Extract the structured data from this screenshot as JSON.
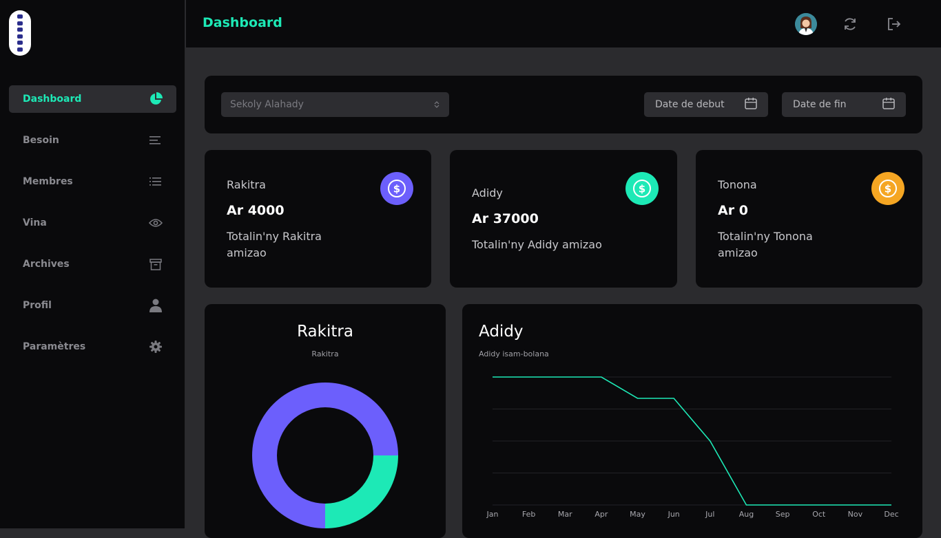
{
  "sidebar": {
    "items": [
      {
        "label": "Dashboard",
        "icon": "pie-chart-icon"
      },
      {
        "label": "Besoin",
        "icon": "align-left-icon"
      },
      {
        "label": "Membres",
        "icon": "list-icon"
      },
      {
        "label": "Vina",
        "icon": "eye-icon"
      },
      {
        "label": "Archives",
        "icon": "archive-icon"
      },
      {
        "label": "Profil",
        "icon": "user-icon"
      },
      {
        "label": "Paramètres",
        "icon": "gear-icon"
      }
    ],
    "active": "Dashboard"
  },
  "header": {
    "title": "Dashboard"
  },
  "filters": {
    "school_select": "Sekoly Alahady",
    "date_start": "Date de debut",
    "date_end": "Date de fin"
  },
  "cards": [
    {
      "title": "Rakitra",
      "value": "Ar 4000",
      "desc": "Totalin'ny Rakitra amizao",
      "color": "#6c5ffc"
    },
    {
      "title": "Adidy",
      "value": "Ar 37000",
      "desc": "Totalin'ny Adidy amizao",
      "color": "#1de9b6"
    },
    {
      "title": "Tonona",
      "value": "Ar 0",
      "desc": "Totalin'ny Tonona amizao",
      "color": "#f5a623"
    }
  ],
  "colors": {
    "accent": "#1de9b6",
    "purple": "#6c5ffc",
    "orange": "#f5a623"
  },
  "chart_data": [
    {
      "type": "pie",
      "title": "Rakitra",
      "subtitle": "Rakitra",
      "donut": true,
      "values": [
        75,
        25
      ],
      "colors": [
        "#6c5ffc",
        "#1de9b6"
      ]
    },
    {
      "type": "line",
      "title": "Adidy",
      "subtitle": "Adidy isam-bolana",
      "categories": [
        "Jan",
        "Feb",
        "Mar",
        "Apr",
        "May",
        "Jun",
        "Jul",
        "Aug",
        "Sep",
        "Oct",
        "Nov",
        "Dec"
      ],
      "values": [
        10000,
        10000,
        10000,
        10000,
        8000,
        8000,
        4000,
        -2000,
        -2000,
        -2000,
        -2000,
        -2000
      ],
      "ylim": [
        -2000,
        10000
      ],
      "grid": true,
      "color": "#1de9b6"
    }
  ]
}
